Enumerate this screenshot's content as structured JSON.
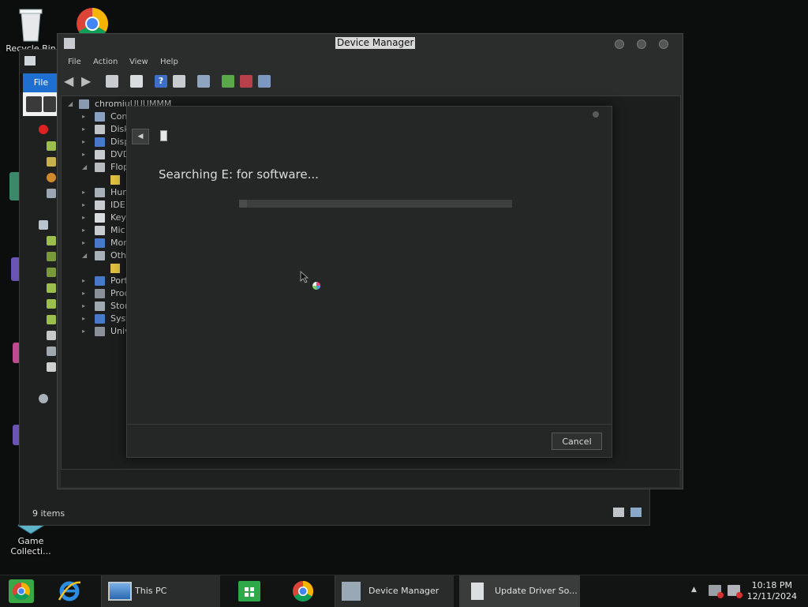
{
  "desktop": {
    "icons": [
      {
        "label": "Recycle Bin"
      },
      {
        "label": "Game Collecti..."
      }
    ]
  },
  "explorer": {
    "file_tab": "File",
    "status_items": "9 items"
  },
  "device_manager": {
    "title": "Device Manager",
    "menu": [
      "File",
      "Action",
      "View",
      "Help"
    ],
    "tree_root": "chromiuUUUMMM",
    "tree_items": [
      "Con",
      "Disk",
      "Disp",
      "DVD",
      "Flop",
      "Hun",
      "IDE",
      "Key",
      "Mic",
      "Mon",
      "Oth",
      "Port",
      "Proc",
      "Stor",
      "Syst",
      "Univ"
    ]
  },
  "wizard": {
    "heading": "Searching E: for software...",
    "progress_fraction": 0.03,
    "cancel_label": "Cancel"
  },
  "taskbar": {
    "items": [
      {
        "label": "This PC"
      },
      {
        "label": "Device Manager"
      },
      {
        "label": "Update Driver So..."
      }
    ],
    "time": "10:18 PM",
    "date": "12/11/2024"
  }
}
